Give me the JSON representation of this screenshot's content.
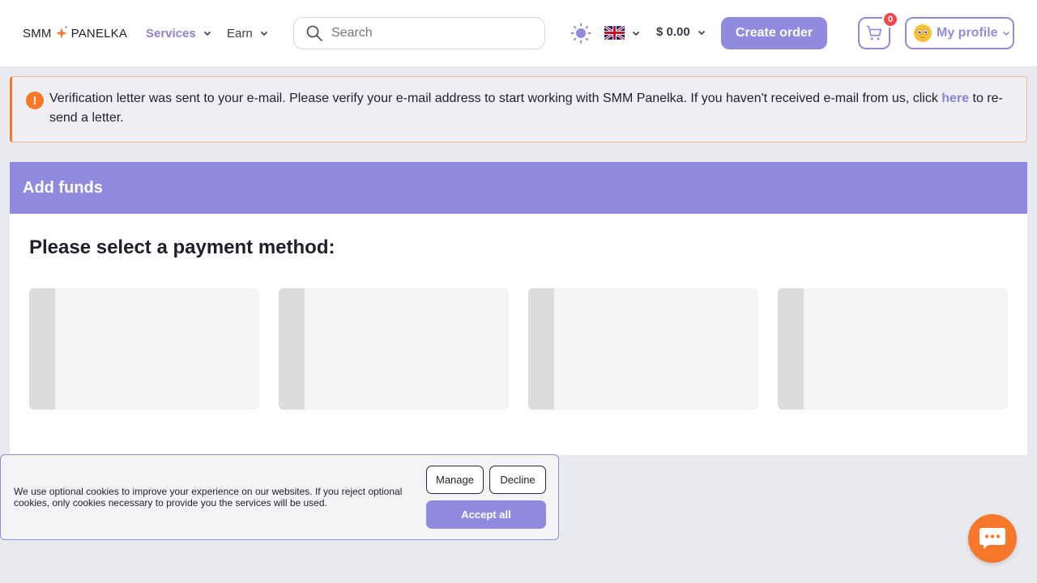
{
  "colors": {
    "accent": "#918be0",
    "accent_text": "#8b84d7",
    "warning": "#f7772b",
    "badge": "#f04848",
    "background": "#e9eaf0"
  },
  "header": {
    "logo_left": "SMM",
    "logo_right": "PANELKA",
    "nav": [
      {
        "label": "Services",
        "icon": "chevron-down-icon",
        "active": true
      },
      {
        "label": "Earn",
        "icon": "chevron-down-icon",
        "active": false
      }
    ],
    "search": {
      "placeholder": "Search",
      "value": "",
      "icon": "search-icon"
    },
    "theme_icon": "sun-icon",
    "language_icon": "uk-flag-icon",
    "balance": "$ 0.00",
    "create_order_label": "Create order",
    "cart": {
      "icon": "cart-icon",
      "count": "0"
    },
    "profile": {
      "label": "My profile",
      "icon": "avatar-icon"
    }
  },
  "alert": {
    "icon": "exclamation-icon",
    "text_before": "Verification letter was sent to your e-mail. Please verify your e-mail address to start working with SMM Panelka. If you haven't received e-mail from us, click ",
    "link_text": "here",
    "text_after": " to re-send a letter."
  },
  "add_funds": {
    "title": "Add funds",
    "subtitle": "Please select a payment method:",
    "payment_methods_loading": 4
  },
  "cookie_banner": {
    "text": "We use optional cookies to improve your experience on our websites. If you reject optional cookies, only cookies necessary to provide you the services will be used.",
    "manage_label": "Manage",
    "decline_label": "Decline",
    "accept_label": "Accept all"
  },
  "chat": {
    "icon": "chat-icon"
  }
}
